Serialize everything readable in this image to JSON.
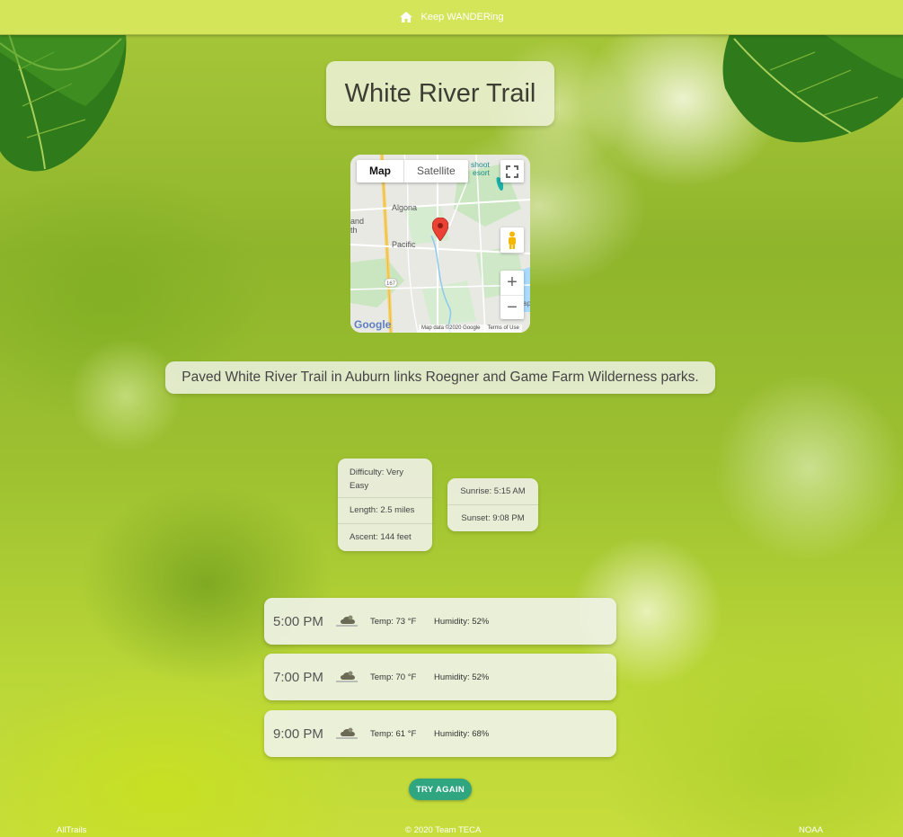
{
  "header": {
    "brand": "Keep WANDERing",
    "icon": "home-icon"
  },
  "trail": {
    "name": "White River Trail",
    "description": "Paved White River Trail in Auburn links Roegner and Game Farm Wilderness parks."
  },
  "map": {
    "type_map": "Map",
    "type_satellite": "Satellite",
    "labels": {
      "algona": "Algona",
      "pacific": "Pacific",
      "land": "and",
      "land2": "th",
      "resort1": "shoot",
      "resort2": "esort",
      "route": "167",
      "sp": "ap"
    },
    "attribution": "Map data ©2020 Google",
    "terms": "Terms of Use",
    "google": "Google",
    "zoom_in": "+",
    "zoom_out": "−"
  },
  "stats": {
    "difficulty": "Difficulty: Very Easy",
    "length": "Length: 2.5 miles",
    "ascent": "Ascent: 144 feet"
  },
  "sun": {
    "sunrise": "Sunrise: 5:15 AM",
    "sunset": "Sunset: 9:08 PM"
  },
  "forecast": [
    {
      "time": "5:00 PM",
      "temp": "Temp: 73 °F",
      "humidity": "Humidity: 52%",
      "icon": "cloud-sun-icon"
    },
    {
      "time": "7:00 PM",
      "temp": "Temp: 70 °F",
      "humidity": "Humidity: 52%",
      "icon": "cloud-sun-icon"
    },
    {
      "time": "9:00 PM",
      "temp": "Temp: 61 °F",
      "humidity": "Humidity: 68%",
      "icon": "cloud-sun-icon"
    }
  ],
  "try_again": "TRY AGAIN",
  "footer": {
    "left": "AllTrails",
    "center": "© 2020 Team TECA",
    "right": "NOAA"
  },
  "colors": {
    "topbar": "#d4e55a",
    "button": "#2fa67f"
  }
}
